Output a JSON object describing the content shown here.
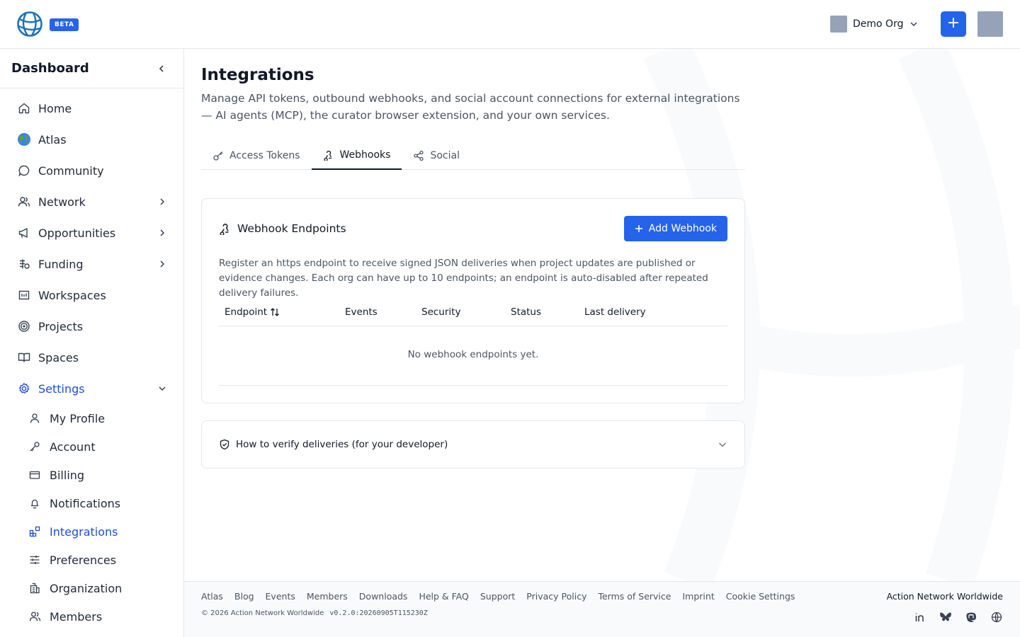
{
  "header": {
    "beta_label": "BETA",
    "org_name": "Demo Org",
    "add_label": "+"
  },
  "sidebar": {
    "title": "Dashboard",
    "items": [
      {
        "label": "Home",
        "icon": "home-icon"
      },
      {
        "label": "Atlas",
        "icon": "globe-emoji-icon"
      },
      {
        "label": "Community",
        "icon": "chat-bubble-icon"
      },
      {
        "label": "Network",
        "icon": "users-icon"
      },
      {
        "label": "Opportunities",
        "icon": "megaphone-icon"
      },
      {
        "label": "Funding",
        "icon": "funding-icon"
      },
      {
        "label": "Workspaces",
        "icon": "calendar-icon"
      },
      {
        "label": "Projects",
        "icon": "target-icon"
      },
      {
        "label": "Spaces",
        "icon": "book-icon"
      },
      {
        "label": "Settings",
        "icon": "gear-icon"
      }
    ],
    "settings_items": [
      {
        "label": "My Profile",
        "icon": "user-icon"
      },
      {
        "label": "Account",
        "icon": "key-icon"
      },
      {
        "label": "Billing",
        "icon": "credit-card-icon"
      },
      {
        "label": "Notifications",
        "icon": "bell-icon"
      },
      {
        "label": "Integrations",
        "icon": "blocks-icon"
      },
      {
        "label": "Preferences",
        "icon": "sliders-icon"
      },
      {
        "label": "Organization",
        "icon": "building-icon"
      },
      {
        "label": "Members",
        "icon": "users-icon"
      }
    ]
  },
  "page": {
    "title": "Integrations",
    "description": "Manage API tokens, outbound webhooks, and social account connections for external integrations — AI agents (MCP), the curator browser extension, and your own services.",
    "tabs": [
      {
        "label": "Access Tokens",
        "icon": "key-icon"
      },
      {
        "label": "Webhooks",
        "icon": "webhook-icon",
        "active": true
      },
      {
        "label": "Social",
        "icon": "share-icon"
      }
    ]
  },
  "webhooks": {
    "title": "Webhook Endpoints",
    "add_button": "Add Webhook",
    "description": "Register an https endpoint to receive signed JSON deliveries when project updates are published or evidence changes. Each org can have up to 10 endpoints; an endpoint is auto-disabled after repeated delivery failures.",
    "columns": [
      "Endpoint",
      "Events",
      "Security",
      "Status",
      "Last delivery"
    ],
    "empty_text": "No webhook endpoints yet."
  },
  "verify": {
    "title": "How to verify deliveries (for your developer)"
  },
  "footer": {
    "links": [
      "Atlas",
      "Blog",
      "Events",
      "Members",
      "Downloads",
      "Help & FAQ",
      "Support",
      "Privacy Policy",
      "Terms of Service",
      "Imprint",
      "Cookie Settings"
    ],
    "copyright": "© 2026 Action Network Worldwide",
    "version": "v0.2.0:20260905T115230Z",
    "brand": "Action Network Worldwide"
  },
  "colors": {
    "accent": "#2563eb",
    "active_text": "#1d4ed8"
  }
}
